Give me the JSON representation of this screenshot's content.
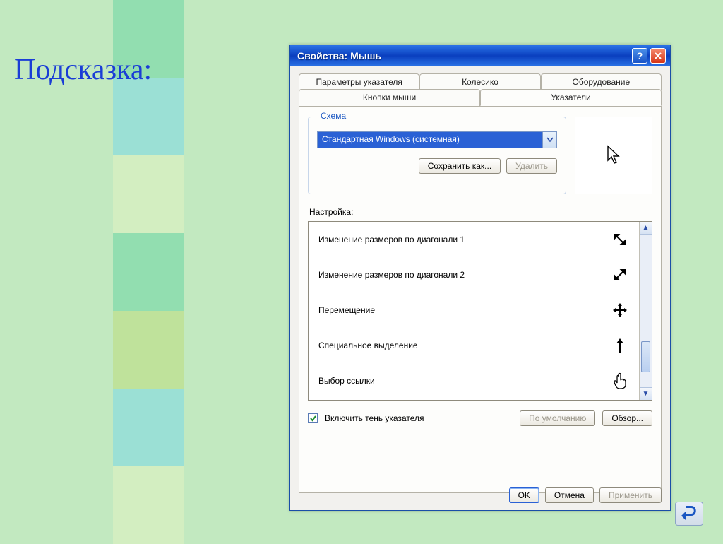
{
  "slide": {
    "hint_label": "Подсказка:"
  },
  "window": {
    "title": "Свойства: Мышь"
  },
  "tabs": {
    "row1": [
      "Параметры указателя",
      "Колесико",
      "Оборудование"
    ],
    "row2": [
      "Кнопки мыши",
      "Указатели"
    ],
    "active": "Указатели"
  },
  "scheme": {
    "legend": "Схема",
    "selected": "Стандартная Windows (системная)",
    "save_as_label": "Сохранить как...",
    "delete_label": "Удалить"
  },
  "customize_label": "Настройка:",
  "cursors": {
    "items": [
      {
        "label": "Изменение размеров по диагонали 1",
        "icon": "resize-nwse-icon"
      },
      {
        "label": "Изменение размеров по диагонали 2",
        "icon": "resize-nesw-icon"
      },
      {
        "label": "Перемещение",
        "icon": "move-icon"
      },
      {
        "label": "Специальное выделение",
        "icon": "up-arrow-icon"
      },
      {
        "label": "Выбор ссылки",
        "icon": "link-hand-icon"
      }
    ]
  },
  "shadow": {
    "checked": true,
    "label": "Включить тень указателя"
  },
  "defaults_label": "По умолчанию",
  "browse_label": "Обзор...",
  "buttons": {
    "ok": "OK",
    "cancel": "Отмена",
    "apply": "Применить"
  }
}
